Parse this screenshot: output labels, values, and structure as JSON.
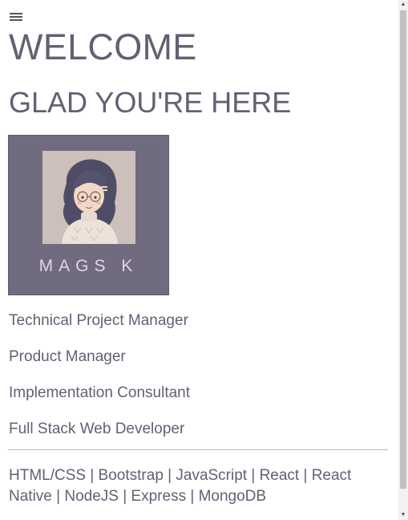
{
  "nav": {
    "menu_icon": "hamburger-menu-icon"
  },
  "hero": {
    "title": "WELCOME",
    "subtitle": "GLAD YOU'RE HERE"
  },
  "avatar": {
    "name": "MAGS K",
    "colors": {
      "frame": "#716b80",
      "portrait_bg": "#cfc1bf"
    }
  },
  "roles": [
    "Technical Project Manager",
    "Product Manager",
    "Implementation Consultant",
    "Full Stack Web Developer"
  ],
  "skills": "HTML/CSS | Bootstrap | JavaScript | React | React Native | NodeJS | Express | MongoDB",
  "colors": {
    "text": "#645f73",
    "divider": "#b8b6bd"
  },
  "scrollbar": {
    "up_icon": "scroll-up-arrow-icon",
    "down_icon": "scroll-down-arrow-icon"
  }
}
